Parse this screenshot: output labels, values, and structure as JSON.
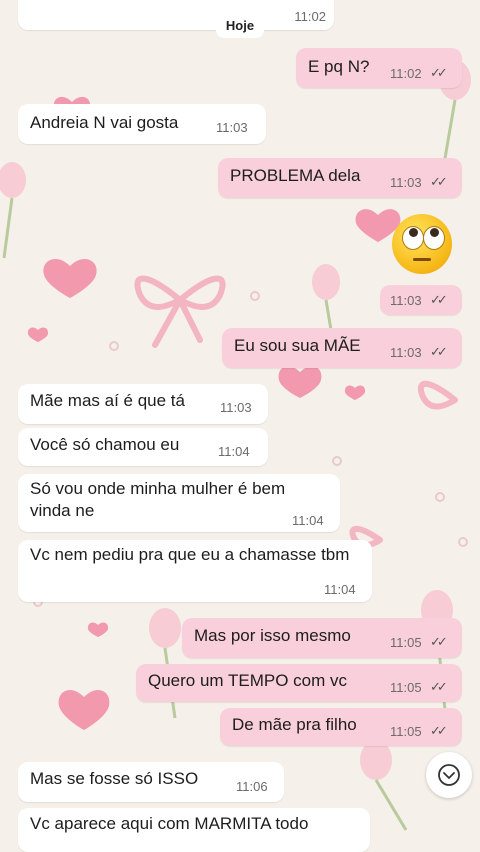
{
  "date_chip": "Hoje",
  "top_partial_time": "11:02",
  "messages": [
    {
      "dir": "out",
      "text": "E pq N?",
      "time": "11:02",
      "ticks": "✓✓"
    },
    {
      "dir": "in",
      "text": "Andreia N vai gosta",
      "time": "11:03"
    },
    {
      "dir": "out",
      "text": "PROBLEMA dela",
      "time": "11:03",
      "ticks": "✓✓"
    },
    {
      "dir": "out",
      "text": "",
      "time": "11:03",
      "ticks": "✓✓",
      "emoji": "eye-roll-emoji"
    },
    {
      "dir": "out",
      "text": "Eu sou sua MÃE",
      "time": "11:03",
      "ticks": "✓✓"
    },
    {
      "dir": "in",
      "text": "Mãe mas aí é que tá",
      "time": "11:03"
    },
    {
      "dir": "in",
      "text": "Você só chamou eu",
      "time": "11:04"
    },
    {
      "dir": "in",
      "text": "Só vou onde minha mulher é bem vinda ne",
      "time": "11:04"
    },
    {
      "dir": "in",
      "text": "Vc nem pediu pra que eu a chamasse tbm",
      "time": "11:04"
    },
    {
      "dir": "out",
      "text": "Mas por isso mesmo",
      "time": "11:05",
      "ticks": "✓✓"
    },
    {
      "dir": "out",
      "text": "Quero um TEMPO com vc",
      "time": "11:05",
      "ticks": "✓✓"
    },
    {
      "dir": "out",
      "text": "De mãe pra filho",
      "time": "11:05",
      "ticks": "✓✓"
    },
    {
      "dir": "in",
      "text": "Mas se fosse só ISSO",
      "time": "11:06"
    },
    {
      "dir": "in",
      "text": "Vc aparece aqui com MARMITA todo",
      "time": ""
    }
  ],
  "scroll_button_icon": "chevron-down-icon",
  "colors": {
    "incoming": "#ffffff",
    "outgoing": "#f9cfdc",
    "background": "#f6f0ea"
  }
}
